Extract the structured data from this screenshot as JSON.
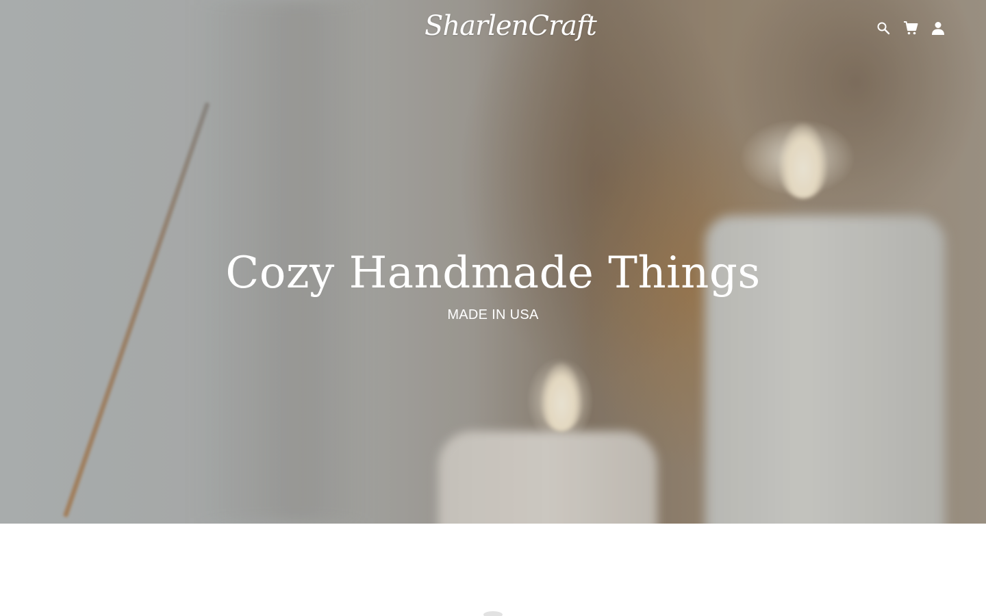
{
  "header": {
    "logo_text": "SharlenCraft",
    "icons": {
      "search": "search-icon",
      "cart": "cart-icon",
      "account": "account-icon"
    }
  },
  "hero": {
    "title": "Cozy Handmade Things",
    "subtitle": "MADE IN USA",
    "image": "blurred candles and incense stick"
  },
  "colors": {
    "hero_text": "#ffffff",
    "page_background": "#ffffff"
  }
}
